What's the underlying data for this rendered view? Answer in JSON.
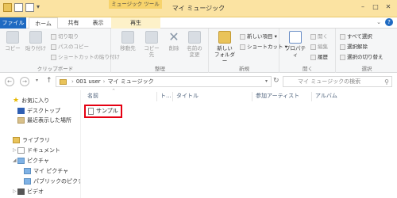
{
  "window": {
    "title": "マイ ミュージック",
    "context_tool_label": "ミュージック ツール"
  },
  "tabs": {
    "file": "ファイル",
    "home": "ホーム",
    "share": "共有",
    "view": "表示",
    "play": "再生"
  },
  "ribbon": {
    "clipboard": {
      "copy": "コピー",
      "paste": "貼り付け",
      "cut": "切り取り",
      "copy_path": "パスのコピー",
      "paste_shortcut": "ショートカットの貼り付け",
      "label": "クリップボード"
    },
    "organize": {
      "move_to": "移動先",
      "copy_to": "コピー先",
      "delete": "削除",
      "rename_line1": "名前の",
      "rename_line2": "変更",
      "label": "整理"
    },
    "new": {
      "new_folder_line1": "新しい",
      "new_folder_line2": "フォルダー",
      "new_item": "新しい項目",
      "shortcut": "ショートカット",
      "label": "新規"
    },
    "open": {
      "properties": "プロパティ",
      "open": "開く",
      "edit": "編集",
      "history": "履歴",
      "label": "開く"
    },
    "select": {
      "select_all": "すべて選択",
      "select_none": "選択解除",
      "invert": "選択の切り替え",
      "label": "選択"
    }
  },
  "address": {
    "crumb1": "001 user",
    "crumb2": "マイ ミュージック",
    "search_placeholder": "マイ ミュージックの検索"
  },
  "nav": {
    "favorites": "お気に入り",
    "desktop": "デスクトップ",
    "recent": "最近表示した場所",
    "libraries": "ライブラリ",
    "documents": "ドキュメント",
    "pictures": "ピクチャ",
    "my_pictures": "マイ ピクチャ",
    "public_pictures": "パブリックのピクチャ",
    "videos": "ビデオ"
  },
  "columns": {
    "name": "名前",
    "track": "ト...",
    "title": "タイトル",
    "artist": "参加アーティスト",
    "album": "アルバム"
  },
  "files": [
    {
      "name": "サンプル"
    }
  ]
}
